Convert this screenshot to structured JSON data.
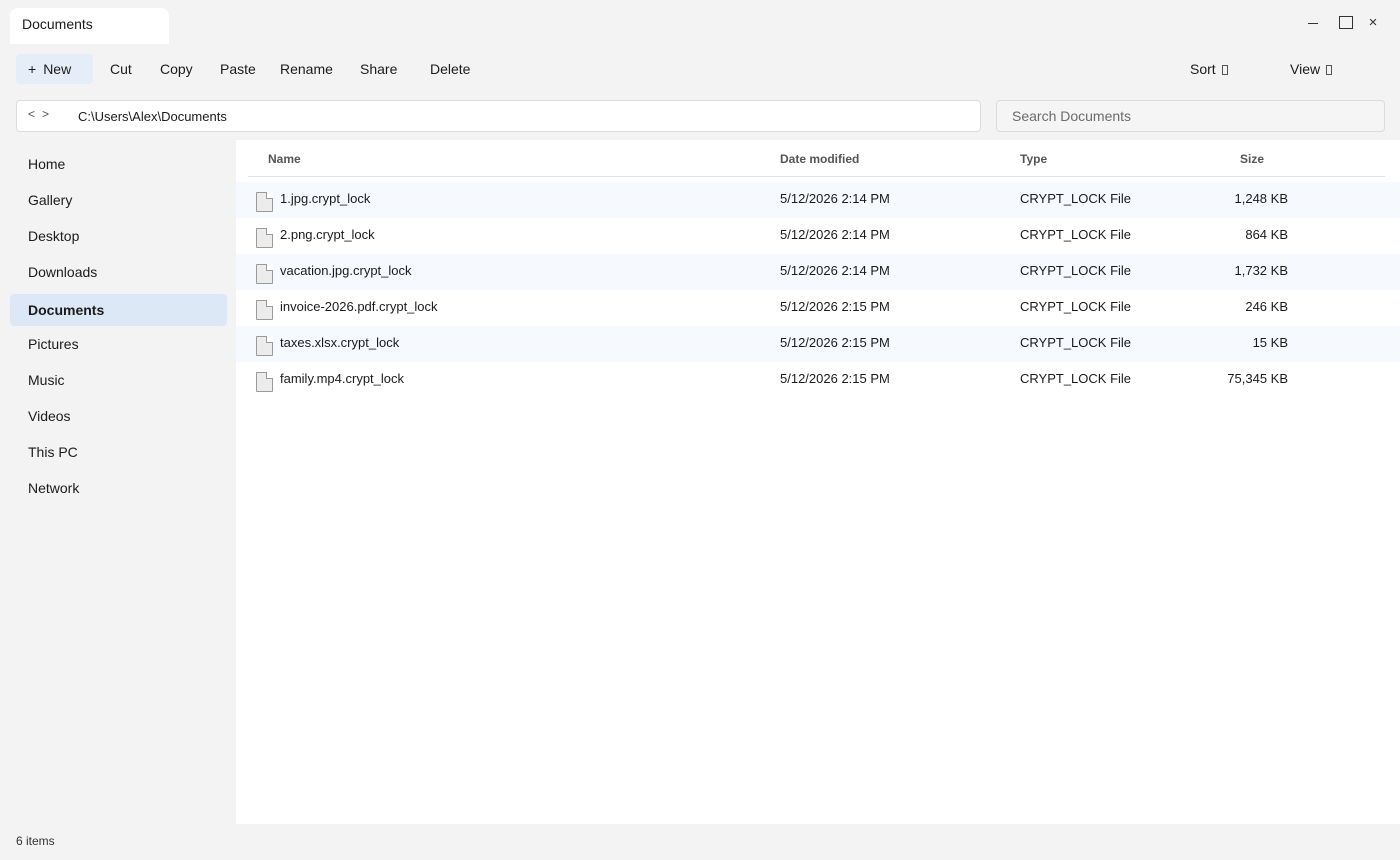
{
  "window": {
    "tab_title": "Documents",
    "controls": {
      "minimize": "minimize-icon",
      "maximize": "maximize-icon",
      "close": "×"
    }
  },
  "toolbar": {
    "new_label": "New",
    "new_icon": "+",
    "cut_label": "Cut",
    "copy_label": "Copy",
    "paste_label": "Paste",
    "rename_label": "Rename",
    "share_label": "Share",
    "delete_label": "Delete",
    "sort_label": "Sort",
    "view_label": "View"
  },
  "address": {
    "back": "<",
    "forward": ">",
    "path": "C:\\Users\\Alex\\Documents"
  },
  "search": {
    "placeholder": "Search Documents",
    "value": ""
  },
  "sidebar": {
    "items": [
      {
        "label": "Home"
      },
      {
        "label": "Gallery"
      },
      {
        "label": "Desktop"
      },
      {
        "label": "Downloads"
      },
      {
        "label": "Documents",
        "active": true
      },
      {
        "label": "Pictures"
      },
      {
        "label": "Music"
      },
      {
        "label": "Videos"
      },
      {
        "label": "This PC"
      },
      {
        "label": "Network"
      }
    ]
  },
  "file_list": {
    "columns": {
      "name": "Name",
      "date": "Date modified",
      "type": "Type",
      "size": "Size"
    },
    "rows": [
      {
        "name": "1.jpg.crypt_lock",
        "date": "5/12/2026 2:14 PM",
        "type": "CRYPT_LOCK File",
        "size": "1,248 KB"
      },
      {
        "name": "2.png.crypt_lock",
        "date": "5/12/2026 2:14 PM",
        "type": "CRYPT_LOCK File",
        "size": "864 KB"
      },
      {
        "name": "vacation.jpg.crypt_lock",
        "date": "5/12/2026 2:14 PM",
        "type": "CRYPT_LOCK File",
        "size": "1,732 KB"
      },
      {
        "name": "invoice-2026.pdf.crypt_lock",
        "date": "5/12/2026 2:15 PM",
        "type": "CRYPT_LOCK File",
        "size": "246 KB"
      },
      {
        "name": "taxes.xlsx.crypt_lock",
        "date": "5/12/2026 2:15 PM",
        "type": "CRYPT_LOCK File",
        "size": "15 KB"
      },
      {
        "name": "family.mp4.crypt_lock",
        "date": "5/12/2026 2:15 PM",
        "type": "CRYPT_LOCK File",
        "size": "75,345 KB"
      }
    ]
  },
  "status": {
    "item_count": "6 items"
  },
  "colors": {
    "active_nav": "#dde8f6",
    "new_button": "#e5eef8",
    "row_alt": "#f6f9fd",
    "chrome": "#f3f3f3"
  }
}
